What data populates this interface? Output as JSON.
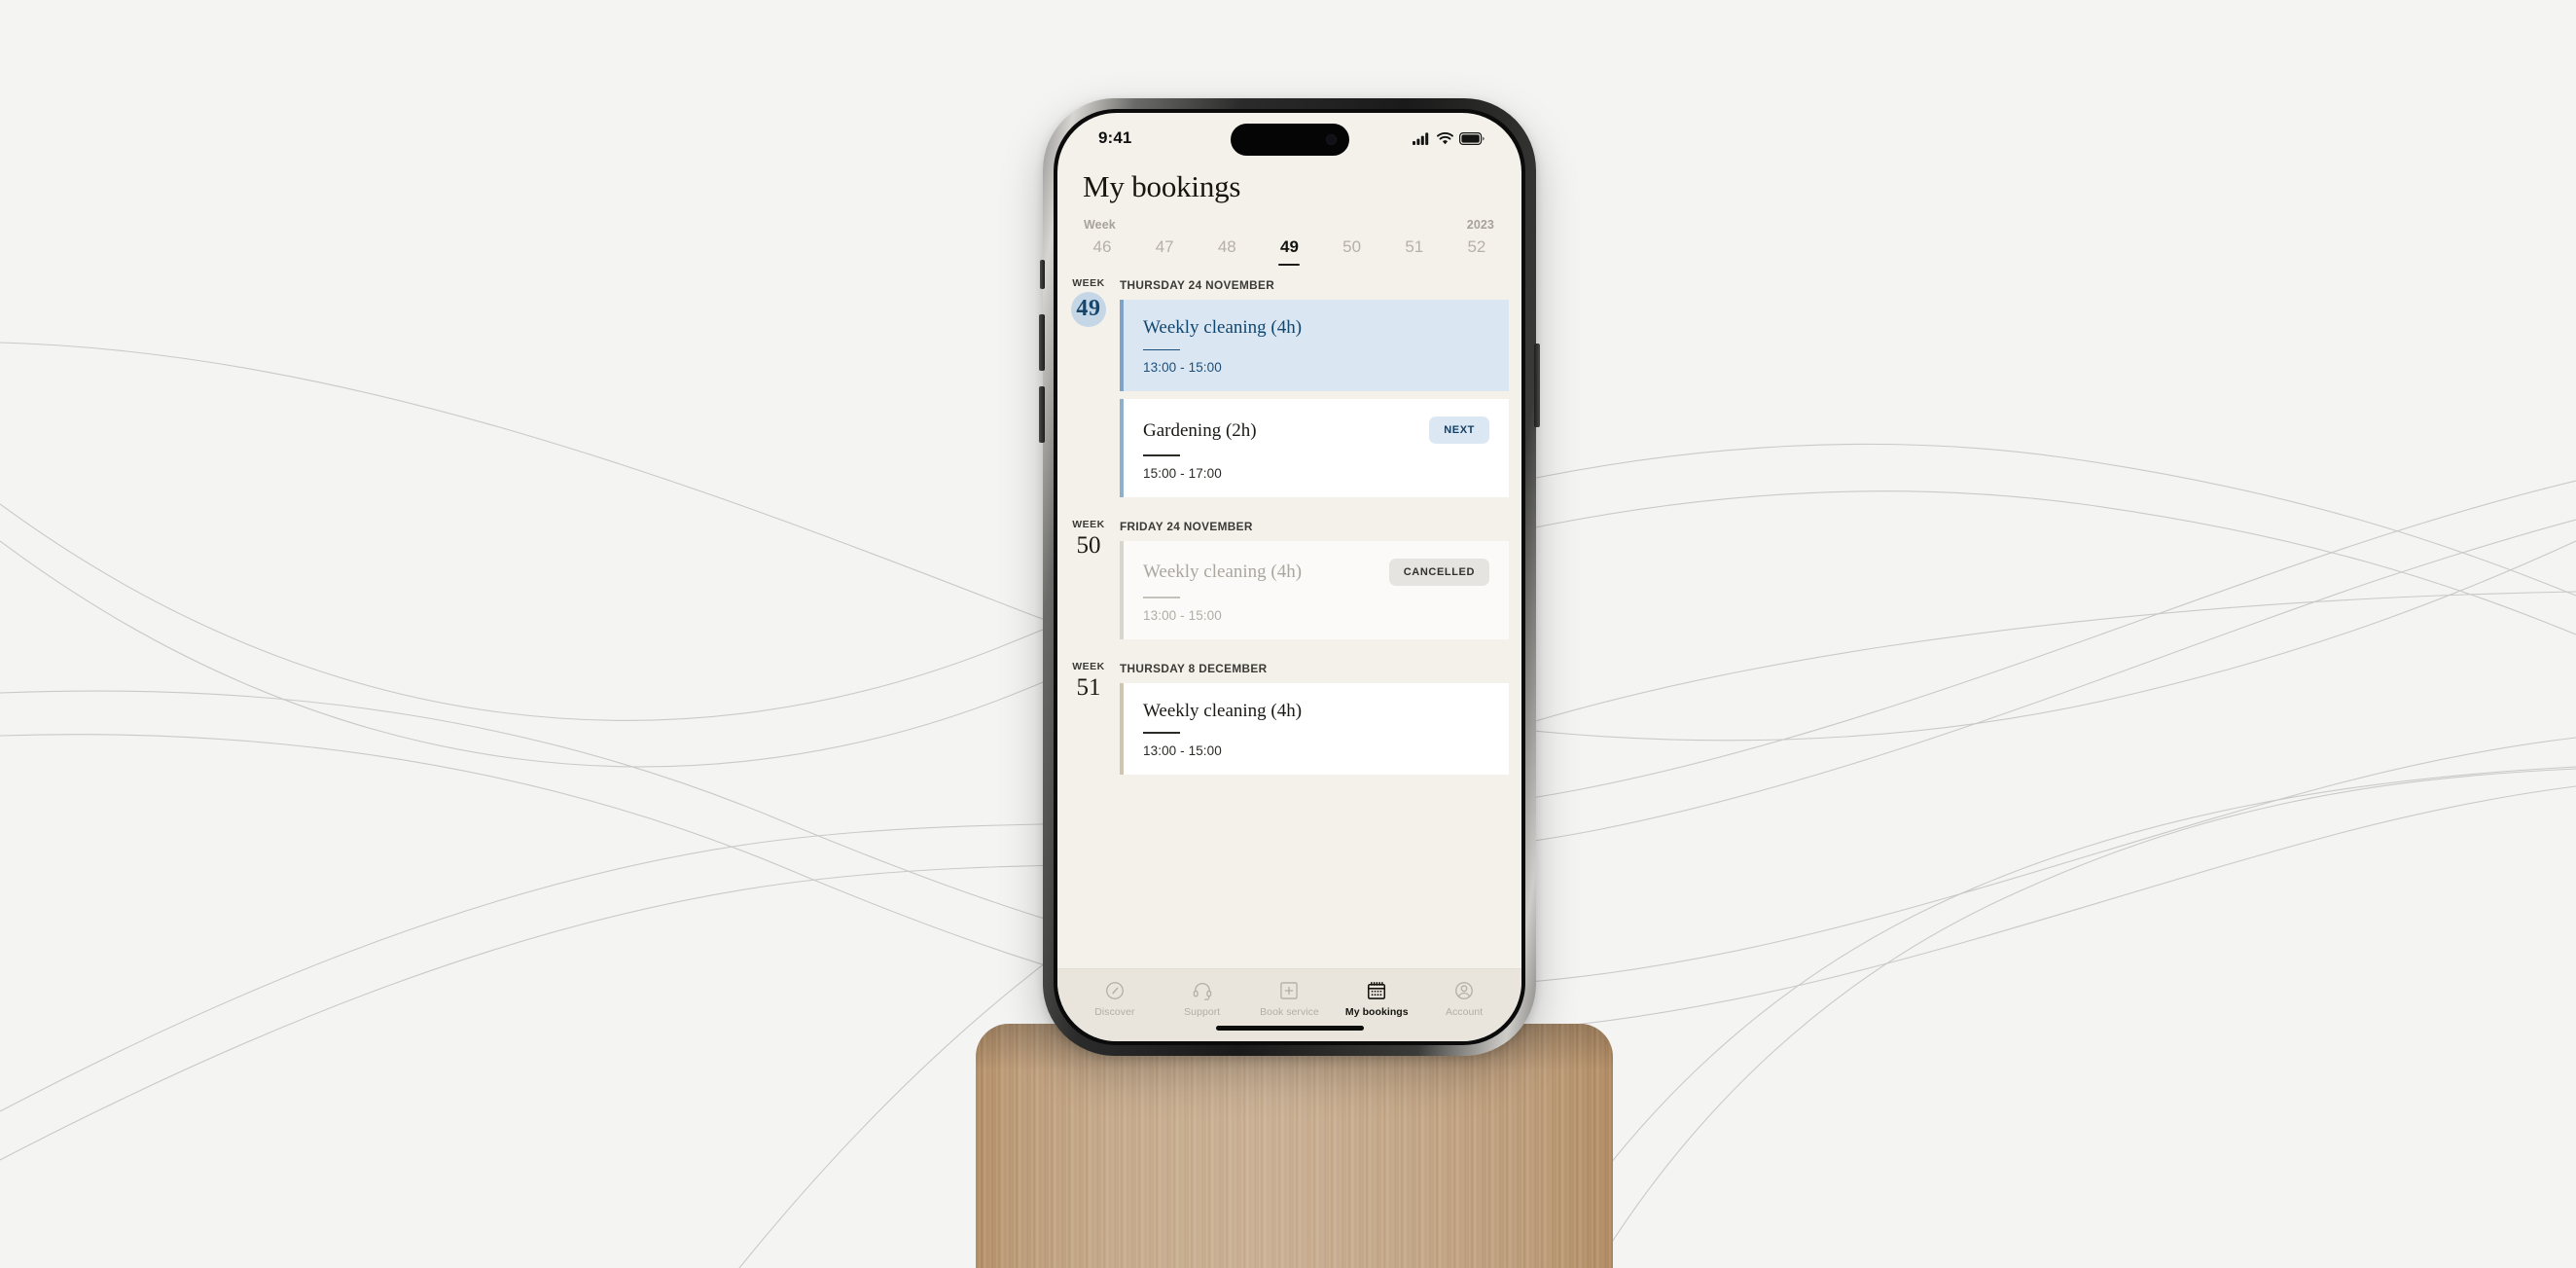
{
  "scene": {
    "background_color": "#f4f4f3",
    "stand_material": "oak-wood-stand",
    "device": "iphone-15-pro"
  },
  "status_bar": {
    "time": "9:41",
    "cellular_icon": "signal-bars-icon",
    "wifi_icon": "wifi-icon",
    "battery_icon": "battery-icon"
  },
  "header": {
    "title": "My bookings",
    "week_label": "Week",
    "year": "2023"
  },
  "week_tabs": [
    {
      "label": "46",
      "active": false
    },
    {
      "label": "47",
      "active": false
    },
    {
      "label": "48",
      "active": false
    },
    {
      "label": "49",
      "active": true
    },
    {
      "label": "50",
      "active": false
    },
    {
      "label": "51",
      "active": false
    },
    {
      "label": "52",
      "active": false
    }
  ],
  "groups": [
    {
      "week_word": "WEEK",
      "week_number": "49",
      "week_highlighted": true,
      "day_label": "THURSDAY 24 NOVEMBER",
      "bookings": [
        {
          "title": "Weekly cleaning (4h)",
          "time": "13:00 - 15:00",
          "state": "highlight",
          "badge": ""
        },
        {
          "title": "Gardening (2h)",
          "time": "15:00 - 17:00",
          "state": "default",
          "badge": "NEXT"
        }
      ]
    },
    {
      "week_word": "WEEK",
      "week_number": "50",
      "week_highlighted": false,
      "day_label": "FRIDAY 24 NOVEMBER",
      "bookings": [
        {
          "title": "Weekly cleaning (4h)",
          "time": "13:00 - 15:00",
          "state": "cancelled",
          "badge": "CANCELLED"
        }
      ]
    },
    {
      "week_word": "WEEK",
      "week_number": "51",
      "week_highlighted": false,
      "day_label": "THURSDAY 8 DECEMBER",
      "bookings": [
        {
          "title": "Weekly cleaning (4h)",
          "time": "13:00 - 15:00",
          "state": "neutral",
          "badge": ""
        }
      ]
    }
  ],
  "tabbar": [
    {
      "label": "Discover",
      "icon": "compass-icon",
      "active": false
    },
    {
      "label": "Support",
      "icon": "headset-icon",
      "active": false
    },
    {
      "label": "Book service",
      "icon": "plus-square-icon",
      "active": false
    },
    {
      "label": "My bookings",
      "icon": "calendar-icon",
      "active": true
    },
    {
      "label": "Account",
      "icon": "user-circle-icon",
      "active": false
    }
  ],
  "colors": {
    "page_bg": "#f4f4f3",
    "app_bg": "#f4f1ea",
    "highlight_card_bg": "#dbe6f3",
    "highlight_text": "#10476f",
    "week_badge_bg": "#c5d7e6",
    "next_badge_bg": "#dce7f4",
    "cancelled_badge_bg": "#e6e4e0",
    "tabbar_bg": "#e9e5dc"
  }
}
